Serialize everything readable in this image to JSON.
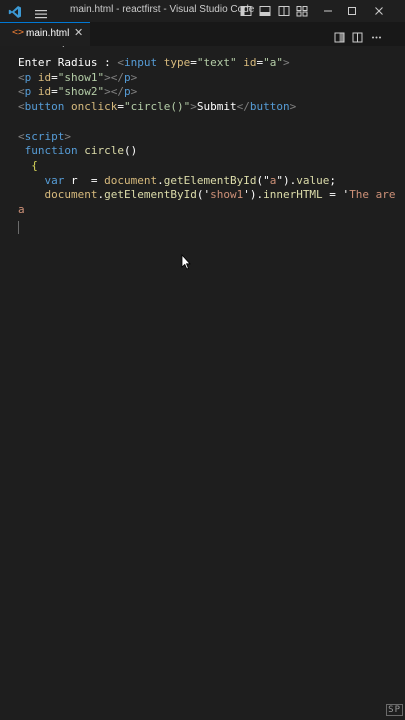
{
  "window": {
    "title": "main.html - reactfirst - Visual Studio Code"
  },
  "titlebar_icons": [
    "vscode-logo-icon",
    "menu-icon",
    "toggle-primary-sidebar-icon",
    "toggle-panel-icon",
    "toggle-secondary-sidebar-icon",
    "customize-layout-icon",
    "minimize-icon",
    "maximize-icon",
    "close-icon"
  ],
  "tab": {
    "icon": "<>",
    "label": "main.html",
    "close": "✕"
  },
  "editor_actions": [
    "open-preview-icon",
    "split-editor-icon",
    "more-actions-icon"
  ],
  "code": {
    "partial_top": "'",
    "lines": [
      [
        {
          "t": "Enter Radius : ",
          "c": "t-text"
        },
        {
          "t": "<",
          "c": "t-punc"
        },
        {
          "t": "input",
          "c": "t-tag"
        },
        {
          "t": " ",
          "c": "t-text"
        },
        {
          "t": "type",
          "c": "t-attrY"
        },
        {
          "t": "=",
          "c": "t-text"
        },
        {
          "t": "\"text\"",
          "c": "t-strG"
        },
        {
          "t": " ",
          "c": "t-text"
        },
        {
          "t": "id",
          "c": "t-attrY"
        },
        {
          "t": "=",
          "c": "t-text"
        },
        {
          "t": "\"a\"",
          "c": "t-strG"
        },
        {
          "t": ">",
          "c": "t-punc"
        }
      ],
      [
        {
          "t": "<",
          "c": "t-punc"
        },
        {
          "t": "p",
          "c": "t-tag"
        },
        {
          "t": " ",
          "c": "t-text"
        },
        {
          "t": "id",
          "c": "t-attrY"
        },
        {
          "t": "=",
          "c": "t-text"
        },
        {
          "t": "\"show1\"",
          "c": "t-strG"
        },
        {
          "t": "></",
          "c": "t-punc"
        },
        {
          "t": "p",
          "c": "t-tag"
        },
        {
          "t": ">",
          "c": "t-punc"
        }
      ],
      [
        {
          "t": "<",
          "c": "t-punc"
        },
        {
          "t": "p",
          "c": "t-tag"
        },
        {
          "t": " ",
          "c": "t-text"
        },
        {
          "t": "id",
          "c": "t-attrY"
        },
        {
          "t": "=",
          "c": "t-text"
        },
        {
          "t": "\"show2\"",
          "c": "t-strG"
        },
        {
          "t": "></",
          "c": "t-punc"
        },
        {
          "t": "p",
          "c": "t-tag"
        },
        {
          "t": ">",
          "c": "t-punc"
        }
      ],
      [
        {
          "t": "<",
          "c": "t-punc"
        },
        {
          "t": "button",
          "c": "t-tag"
        },
        {
          "t": " ",
          "c": "t-text"
        },
        {
          "t": "onclick",
          "c": "t-attrY"
        },
        {
          "t": "=",
          "c": "t-text"
        },
        {
          "t": "\"circle()\"",
          "c": "t-strG"
        },
        {
          "t": ">",
          "c": "t-punc"
        },
        {
          "t": "Submit",
          "c": "t-text"
        },
        {
          "t": "</",
          "c": "t-punc"
        },
        {
          "t": "button",
          "c": "t-tag"
        },
        {
          "t": ">",
          "c": "t-punc"
        }
      ],
      [],
      [
        {
          "t": "<",
          "c": "t-punc"
        },
        {
          "t": "script",
          "c": "t-tag"
        },
        {
          "t": ">",
          "c": "t-punc"
        }
      ],
      [
        {
          "t": " ",
          "c": "t-text"
        },
        {
          "t": "function",
          "c": "t-kw"
        },
        {
          "t": " ",
          "c": "t-text"
        },
        {
          "t": "circle",
          "c": "t-fn"
        },
        {
          "t": "()",
          "c": "t-text"
        }
      ],
      [
        {
          "t": "  {",
          "c": "t-strY"
        }
      ],
      [
        {
          "t": "    ",
          "c": "t-text"
        },
        {
          "t": "var",
          "c": "t-kw"
        },
        {
          "t": " r  = ",
          "c": "t-text"
        },
        {
          "t": "document",
          "c": "t-obj"
        },
        {
          "t": ".",
          "c": "t-text"
        },
        {
          "t": "getElementById",
          "c": "t-fn"
        },
        {
          "t": "(\"",
          "c": "t-text"
        },
        {
          "t": "a",
          "c": "t-str"
        },
        {
          "t": "\").",
          "c": "t-text"
        },
        {
          "t": "value",
          "c": "t-fn"
        },
        {
          "t": ";",
          "c": "t-text"
        }
      ],
      [
        {
          "t": "    ",
          "c": "t-text"
        },
        {
          "t": "document",
          "c": "t-obj"
        },
        {
          "t": ".",
          "c": "t-text"
        },
        {
          "t": "getElementById",
          "c": "t-fn"
        },
        {
          "t": "('",
          "c": "t-text"
        },
        {
          "t": "show1",
          "c": "t-str"
        },
        {
          "t": "').",
          "c": "t-text"
        },
        {
          "t": "innerHTML",
          "c": "t-fn"
        },
        {
          "t": " = '",
          "c": "t-text"
        },
        {
          "t": "The",
          "c": "t-str"
        },
        {
          "t": " area",
          "c": "t-str"
        }
      ]
    ]
  },
  "watermark": "SP"
}
